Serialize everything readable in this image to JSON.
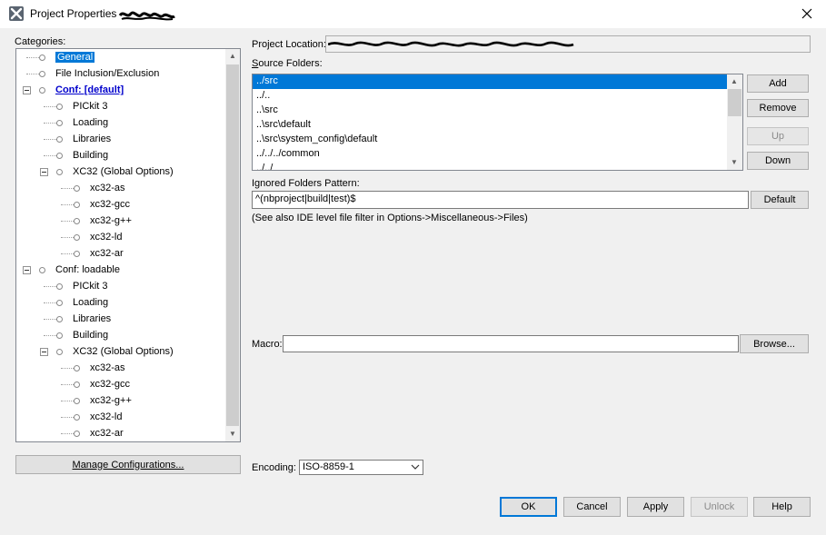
{
  "window": {
    "title": "Project Properties",
    "close_icon": "close-icon"
  },
  "categories": {
    "label": "Categories:",
    "items": [
      {
        "label": "General",
        "level": 1,
        "selected": true
      },
      {
        "label": "File Inclusion/Exclusion",
        "level": 1
      },
      {
        "label": "Conf: [default]",
        "level": 1,
        "expanded": true,
        "bold": true
      },
      {
        "label": "PICkit 3",
        "level": 2
      },
      {
        "label": "Loading",
        "level": 2
      },
      {
        "label": "Libraries",
        "level": 2
      },
      {
        "label": "Building",
        "level": 2
      },
      {
        "label": "XC32 (Global Options)",
        "level": 2,
        "expanded": true
      },
      {
        "label": "xc32-as",
        "level": 3
      },
      {
        "label": "xc32-gcc",
        "level": 3
      },
      {
        "label": "xc32-g++",
        "level": 3
      },
      {
        "label": "xc32-ld",
        "level": 3
      },
      {
        "label": "xc32-ar",
        "level": 3
      },
      {
        "label": "Conf: loadable",
        "level": 1,
        "expanded": true
      },
      {
        "label": "PICkit 3",
        "level": 2
      },
      {
        "label": "Loading",
        "level": 2
      },
      {
        "label": "Libraries",
        "level": 2
      },
      {
        "label": "Building",
        "level": 2
      },
      {
        "label": "XC32 (Global Options)",
        "level": 2,
        "expanded": true
      },
      {
        "label": "xc32-as",
        "level": 3
      },
      {
        "label": "xc32-gcc",
        "level": 3
      },
      {
        "label": "xc32-g++",
        "level": 3
      },
      {
        "label": "xc32-ld",
        "level": 3
      },
      {
        "label": "xc32-ar",
        "level": 3
      }
    ],
    "manage_button": "Manage Configurations..."
  },
  "general": {
    "project_location_label": "Project Location:",
    "source_folders_label": "Source Folders:",
    "source_folders": [
      "../src",
      "../..",
      "..\\src",
      "..\\src\\default",
      "..\\src\\system_config\\default",
      "../../../common",
      "../../"
    ],
    "add_button": "Add",
    "remove_button": "Remove",
    "up_button": "Up",
    "down_button": "Down",
    "ignored_label": "Ignored Folders Pattern:",
    "ignored_value": "^(nbproject|build|test)$",
    "default_button": "Default",
    "hint": "(See also IDE level file filter in Options->Miscellaneous->Files)",
    "macro_label": "Macro:",
    "macro_value": "",
    "browse_button": "Browse...",
    "encoding_label": "Encoding:",
    "encoding_value": "ISO-8859-1"
  },
  "footer": {
    "ok": "OK",
    "cancel": "Cancel",
    "apply": "Apply",
    "unlock": "Unlock",
    "help": "Help"
  }
}
